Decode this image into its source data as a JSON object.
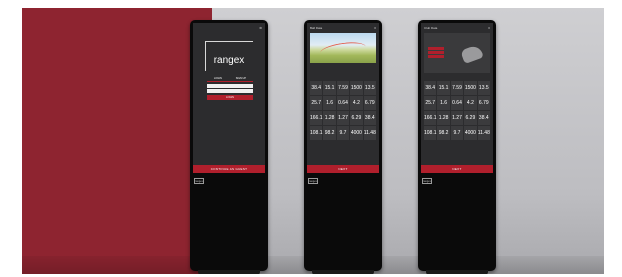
{
  "kiosks": [
    {
      "screen": "login",
      "brand": "rangex",
      "tabs": [
        "LOGIN",
        "SIGN UP"
      ],
      "login_button": "LOGIN",
      "bottom_bar": "CONTINUE AS GUEST",
      "side_logo": "rangex"
    },
    {
      "screen": "ball-data",
      "header": "Ball Data",
      "bottom_bar": "NEXT",
      "side_logo": "rangex",
      "rows": [
        [
          "38.4",
          "15.1",
          "7.59",
          "1500",
          "13.5"
        ],
        [
          "25.7",
          "1.6",
          "0.64",
          "4.2",
          "6.79"
        ],
        [
          "166.1",
          "1.28",
          "1.27",
          "6.29",
          "38.4"
        ],
        [
          "108.1",
          "98.2",
          "9.7",
          "4000",
          "11.48"
        ]
      ]
    },
    {
      "screen": "club-data",
      "header": "Club Data",
      "bottom_bar": "NEXT",
      "side_logo": "rangex",
      "rows": [
        [
          "38.4",
          "15.1",
          "7.59",
          "1500",
          "13.5"
        ],
        [
          "25.7",
          "1.6",
          "0.64",
          "4.2",
          "6.79"
        ],
        [
          "166.1",
          "1.28",
          "1.27",
          "6.29",
          "38.4"
        ],
        [
          "108.1",
          "98.2",
          "9.7",
          "4000",
          "11.48"
        ]
      ]
    }
  ],
  "colors": {
    "accent": "#b01f2c",
    "backdrop_red": "#8e2430",
    "backdrop_grey": "#c4c4c7"
  }
}
